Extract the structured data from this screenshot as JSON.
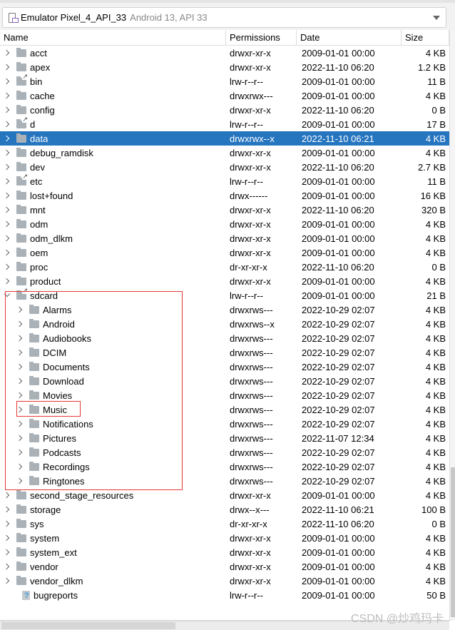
{
  "device": {
    "name": "Emulator Pixel_4_API_33",
    "detail": "Android 13, API 33",
    "icon": "device-icon"
  },
  "columns": [
    "Name",
    "Permissions",
    "Date",
    "Size"
  ],
  "colors": {
    "selection": "#2675bf",
    "highlight_box": "#e53935"
  },
  "rows": [
    {
      "name": "acct",
      "perm": "drwxr-xr-x",
      "date": "2009-01-01 00:00",
      "size": "4 KB",
      "icon": "folder",
      "level": 0,
      "exp": "closed"
    },
    {
      "name": "apex",
      "perm": "drwxr-xr-x",
      "date": "2022-11-10 06:20",
      "size": "1.2 KB",
      "icon": "folder",
      "level": 0,
      "exp": "closed"
    },
    {
      "name": "bin",
      "perm": "lrw-r--r--",
      "date": "2009-01-01 00:00",
      "size": "11 B",
      "icon": "folder-link",
      "level": 0,
      "exp": "closed"
    },
    {
      "name": "cache",
      "perm": "drwxrwx---",
      "date": "2009-01-01 00:00",
      "size": "4 KB",
      "icon": "folder",
      "level": 0,
      "exp": "closed"
    },
    {
      "name": "config",
      "perm": "drwxr-xr-x",
      "date": "2022-11-10 06:20",
      "size": "0 B",
      "icon": "folder",
      "level": 0,
      "exp": "closed"
    },
    {
      "name": "d",
      "perm": "lrw-r--r--",
      "date": "2009-01-01 00:00",
      "size": "17 B",
      "icon": "folder-link",
      "level": 0,
      "exp": "closed"
    },
    {
      "name": "data",
      "perm": "drwxrwx--x",
      "date": "2022-11-10 06:21",
      "size": "4 KB",
      "icon": "folder",
      "level": 0,
      "exp": "closed",
      "selected": true
    },
    {
      "name": "debug_ramdisk",
      "perm": "drwxr-xr-x",
      "date": "2009-01-01 00:00",
      "size": "4 KB",
      "icon": "folder",
      "level": 0,
      "exp": "closed"
    },
    {
      "name": "dev",
      "perm": "drwxr-xr-x",
      "date": "2022-11-10 06:20",
      "size": "2.7 KB",
      "icon": "folder",
      "level": 0,
      "exp": "closed"
    },
    {
      "name": "etc",
      "perm": "lrw-r--r--",
      "date": "2009-01-01 00:00",
      "size": "11 B",
      "icon": "folder-link",
      "level": 0,
      "exp": "closed"
    },
    {
      "name": "lost+found",
      "perm": "drwx------",
      "date": "2009-01-01 00:00",
      "size": "16 KB",
      "icon": "folder",
      "level": 0,
      "exp": "closed"
    },
    {
      "name": "mnt",
      "perm": "drwxr-xr-x",
      "date": "2022-11-10 06:20",
      "size": "320 B",
      "icon": "folder",
      "level": 0,
      "exp": "closed"
    },
    {
      "name": "odm",
      "perm": "drwxr-xr-x",
      "date": "2009-01-01 00:00",
      "size": "4 KB",
      "icon": "folder",
      "level": 0,
      "exp": "closed"
    },
    {
      "name": "odm_dlkm",
      "perm": "drwxr-xr-x",
      "date": "2009-01-01 00:00",
      "size": "4 KB",
      "icon": "folder",
      "level": 0,
      "exp": "closed"
    },
    {
      "name": "oem",
      "perm": "drwxr-xr-x",
      "date": "2009-01-01 00:00",
      "size": "4 KB",
      "icon": "folder",
      "level": 0,
      "exp": "closed"
    },
    {
      "name": "proc",
      "perm": "dr-xr-xr-x",
      "date": "2022-11-10 06:20",
      "size": "0 B",
      "icon": "folder",
      "level": 0,
      "exp": "closed"
    },
    {
      "name": "product",
      "perm": "drwxr-xr-x",
      "date": "2009-01-01 00:00",
      "size": "4 KB",
      "icon": "folder",
      "level": 0,
      "exp": "closed"
    },
    {
      "name": "sdcard",
      "perm": "lrw-r--r--",
      "date": "2009-01-01 00:00",
      "size": "21 B",
      "icon": "folder-link",
      "level": 0,
      "exp": "open"
    },
    {
      "name": "Alarms",
      "perm": "drwxrws---",
      "date": "2022-10-29 02:07",
      "size": "4 KB",
      "icon": "folder",
      "level": 1,
      "exp": "closed"
    },
    {
      "name": "Android",
      "perm": "drwxrws--x",
      "date": "2022-10-29 02:07",
      "size": "4 KB",
      "icon": "folder",
      "level": 1,
      "exp": "closed"
    },
    {
      "name": "Audiobooks",
      "perm": "drwxrws---",
      "date": "2022-10-29 02:07",
      "size": "4 KB",
      "icon": "folder",
      "level": 1,
      "exp": "closed"
    },
    {
      "name": "DCIM",
      "perm": "drwxrws---",
      "date": "2022-10-29 02:07",
      "size": "4 KB",
      "icon": "folder",
      "level": 1,
      "exp": "closed"
    },
    {
      "name": "Documents",
      "perm": "drwxrws---",
      "date": "2022-10-29 02:07",
      "size": "4 KB",
      "icon": "folder",
      "level": 1,
      "exp": "closed"
    },
    {
      "name": "Download",
      "perm": "drwxrws---",
      "date": "2022-10-29 02:07",
      "size": "4 KB",
      "icon": "folder",
      "level": 1,
      "exp": "closed"
    },
    {
      "name": "Movies",
      "perm": "drwxrws---",
      "date": "2022-10-29 02:07",
      "size": "4 KB",
      "icon": "folder",
      "level": 1,
      "exp": "closed"
    },
    {
      "name": "Music",
      "perm": "drwxrws---",
      "date": "2022-10-29 02:07",
      "size": "4 KB",
      "icon": "folder",
      "level": 1,
      "exp": "closed"
    },
    {
      "name": "Notifications",
      "perm": "drwxrws---",
      "date": "2022-10-29 02:07",
      "size": "4 KB",
      "icon": "folder",
      "level": 1,
      "exp": "closed"
    },
    {
      "name": "Pictures",
      "perm": "drwxrws---",
      "date": "2022-11-07 12:34",
      "size": "4 KB",
      "icon": "folder",
      "level": 1,
      "exp": "closed"
    },
    {
      "name": "Podcasts",
      "perm": "drwxrws---",
      "date": "2022-10-29 02:07",
      "size": "4 KB",
      "icon": "folder",
      "level": 1,
      "exp": "closed"
    },
    {
      "name": "Recordings",
      "perm": "drwxrws---",
      "date": "2022-10-29 02:07",
      "size": "4 KB",
      "icon": "folder",
      "level": 1,
      "exp": "closed"
    },
    {
      "name": "Ringtones",
      "perm": "drwxrws---",
      "date": "2022-10-29 02:07",
      "size": "4 KB",
      "icon": "folder",
      "level": 1,
      "exp": "closed"
    },
    {
      "name": "second_stage_resources",
      "perm": "drwxr-xr-x",
      "date": "2009-01-01 00:00",
      "size": "4 KB",
      "icon": "folder",
      "level": 0,
      "exp": "closed"
    },
    {
      "name": "storage",
      "perm": "drwx--x---",
      "date": "2022-11-10 06:21",
      "size": "100 B",
      "icon": "folder",
      "level": 0,
      "exp": "closed"
    },
    {
      "name": "sys",
      "perm": "dr-xr-xr-x",
      "date": "2022-11-10 06:20",
      "size": "0 B",
      "icon": "folder",
      "level": 0,
      "exp": "closed"
    },
    {
      "name": "system",
      "perm": "drwxr-xr-x",
      "date": "2009-01-01 00:00",
      "size": "4 KB",
      "icon": "folder",
      "level": 0,
      "exp": "closed"
    },
    {
      "name": "system_ext",
      "perm": "drwxr-xr-x",
      "date": "2009-01-01 00:00",
      "size": "4 KB",
      "icon": "folder",
      "level": 0,
      "exp": "closed"
    },
    {
      "name": "vendor",
      "perm": "drwxr-xr-x",
      "date": "2009-01-01 00:00",
      "size": "4 KB",
      "icon": "folder",
      "level": 0,
      "exp": "closed"
    },
    {
      "name": "vendor_dlkm",
      "perm": "drwxr-xr-x",
      "date": "2009-01-01 00:00",
      "size": "4 KB",
      "icon": "folder",
      "level": 0,
      "exp": "closed"
    },
    {
      "name": "bugreports",
      "perm": "lrw-r--r--",
      "date": "2009-01-01 00:00",
      "size": "50 B",
      "icon": "unknown-link",
      "level": 0,
      "exp": "none"
    }
  ],
  "watermark": "CSDN @炒鸡玛卡"
}
